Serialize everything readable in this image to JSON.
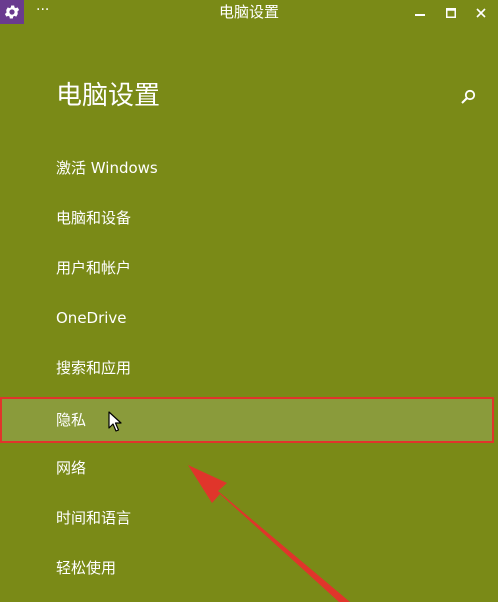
{
  "window": {
    "title": "电脑设置",
    "menu_glyph": "···"
  },
  "header": {
    "title": "电脑设置"
  },
  "nav": {
    "items": [
      {
        "label": "激活 Windows"
      },
      {
        "label": "电脑和设备"
      },
      {
        "label": "用户和帐户"
      },
      {
        "label": "OneDrive"
      },
      {
        "label": "搜索和应用"
      },
      {
        "label": "隐私",
        "selected": true
      },
      {
        "label": "网络"
      },
      {
        "label": "时间和语言"
      },
      {
        "label": "轻松使用"
      }
    ]
  },
  "icons": {
    "app": "gear-icon",
    "search": "search-icon",
    "minimize": "minimize-icon",
    "maximize": "maximize-icon",
    "close": "close-icon",
    "cursor": "mouse-pointer-icon",
    "annotation": "red-arrow-icon"
  },
  "colors": {
    "background": "#7a8a17",
    "app_icon_bg": "#6a3b8f",
    "selected_bg": "#8a9b3b",
    "highlight_border": "#e0352b",
    "arrow": "#e0352b",
    "text": "#ffffff"
  }
}
